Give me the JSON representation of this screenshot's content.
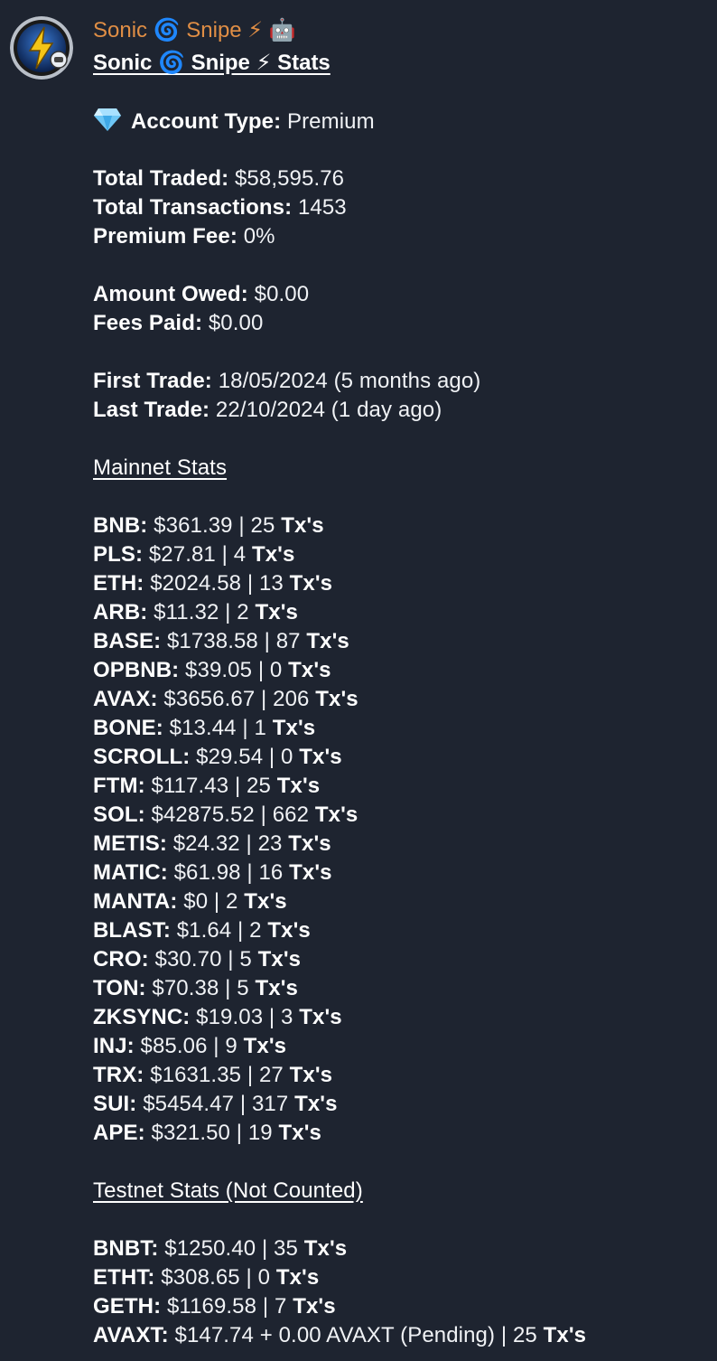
{
  "chat": {
    "sender_name": "Sonic 🌀 Snipe ⚡ 🤖",
    "avatar_icon": "lightning-bolt-icon"
  },
  "message": {
    "title": "Sonic 🌀 Snipe ⚡ Stats",
    "account_type": {
      "icon": "diamond-icon",
      "label": "Account Type:",
      "value": "Premium"
    },
    "totals": [
      {
        "label": "Total Traded:",
        "value": "$58,595.76"
      },
      {
        "label": "Total Transactions:",
        "value": "1453"
      },
      {
        "label": "Premium Fee:",
        "value": "0%"
      }
    ],
    "fees": [
      {
        "label": "Amount Owed:",
        "value": "$0.00"
      },
      {
        "label": "Fees Paid:",
        "value": "$0.00"
      }
    ],
    "trades": [
      {
        "label": "First Trade:",
        "value": "18/05/2024 (5 months ago)"
      },
      {
        "label": "Last Trade:",
        "value": "22/10/2024 (1 day ago)"
      }
    ],
    "mainnet": {
      "header": "Mainnet Stats",
      "rows": [
        {
          "chain": "BNB:",
          "detail": "$361.39 | 25",
          "tx": "Tx's"
        },
        {
          "chain": "PLS:",
          "detail": "$27.81 | 4",
          "tx": "Tx's"
        },
        {
          "chain": "ETH:",
          "detail": "$2024.58 | 13",
          "tx": "Tx's"
        },
        {
          "chain": "ARB:",
          "detail": "$11.32 | 2",
          "tx": "Tx's"
        },
        {
          "chain": "BASE:",
          "detail": "$1738.58 | 87",
          "tx": "Tx's"
        },
        {
          "chain": "OPBNB:",
          "detail": "$39.05 | 0",
          "tx": "Tx's"
        },
        {
          "chain": "AVAX:",
          "detail": "$3656.67 | 206",
          "tx": "Tx's"
        },
        {
          "chain": "BONE:",
          "detail": "$13.44 | 1",
          "tx": "Tx's"
        },
        {
          "chain": "SCROLL:",
          "detail": "$29.54 | 0",
          "tx": "Tx's"
        },
        {
          "chain": "FTM:",
          "detail": "$117.43 | 25",
          "tx": "Tx's"
        },
        {
          "chain": "SOL:",
          "detail": "$42875.52 | 662",
          "tx": "Tx's"
        },
        {
          "chain": "METIS:",
          "detail": "$24.32 | 23",
          "tx": "Tx's"
        },
        {
          "chain": "MATIC:",
          "detail": "$61.98 | 16",
          "tx": "Tx's"
        },
        {
          "chain": "MANTA:",
          "detail": "$0 | 2",
          "tx": "Tx's"
        },
        {
          "chain": "BLAST:",
          "detail": "$1.64 | 2",
          "tx": "Tx's"
        },
        {
          "chain": "CRO:",
          "detail": "$30.70 | 5",
          "tx": "Tx's"
        },
        {
          "chain": "TON:",
          "detail": "$70.38 | 5",
          "tx": "Tx's"
        },
        {
          "chain": "ZKSYNC:",
          "detail": "$19.03 | 3",
          "tx": "Tx's"
        },
        {
          "chain": "INJ:",
          "detail": "$85.06 | 9",
          "tx": "Tx's"
        },
        {
          "chain": "TRX:",
          "detail": "$1631.35 | 27",
          "tx": "Tx's"
        },
        {
          "chain": "SUI:",
          "detail": "$5454.47 | 317",
          "tx": "Tx's"
        },
        {
          "chain": "APE:",
          "detail": "$321.50 | 19",
          "tx": "Tx's"
        }
      ]
    },
    "testnet": {
      "header": "Testnet Stats (Not Counted)",
      "rows": [
        {
          "chain": "BNBT:",
          "detail": "$1250.40 | 35",
          "tx": "Tx's"
        },
        {
          "chain": "ETHT:",
          "detail": "$308.65 | 0",
          "tx": "Tx's"
        },
        {
          "chain": "GETH:",
          "detail": "$1169.58 | 7",
          "tx": "Tx's"
        },
        {
          "chain": "AVAXT:",
          "detail": "$147.74 + 0.00 AVAXT (Pending) | 25",
          "tx": "Tx's"
        }
      ]
    }
  }
}
